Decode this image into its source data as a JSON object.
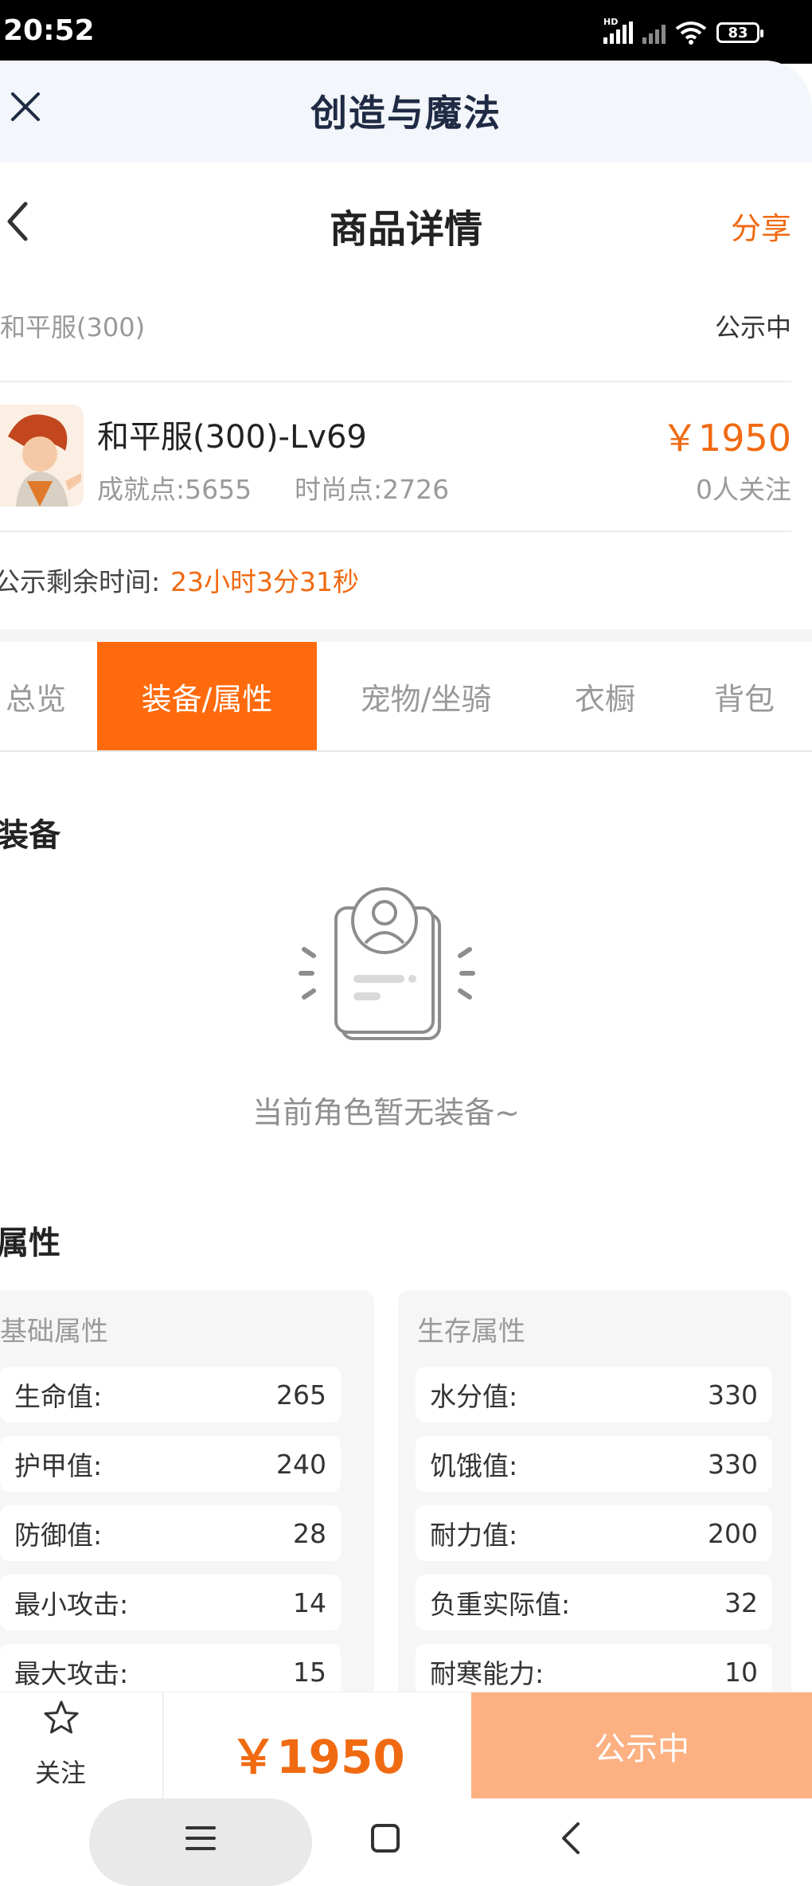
{
  "status_bar": {
    "time": "20:52",
    "network_label": "HD",
    "battery": "83"
  },
  "app_bar": {
    "title": "创造与魔法"
  },
  "nav": {
    "title": "商品详情",
    "share_label": "分享"
  },
  "product": {
    "server": "和平服(300)",
    "status": "公示中",
    "name": "和平服(300)-Lv69",
    "achievement": "成就点:5655",
    "fashion": "时尚点:2726",
    "price": "￥1950",
    "followers": "0人关注",
    "remaining_label": "公示剩余时间:",
    "remaining_value": "23小时3分31秒"
  },
  "tabs": [
    {
      "label": "总览",
      "active": false
    },
    {
      "label": "装备/属性",
      "active": true
    },
    {
      "label": "宠物/坐骑",
      "active": false
    },
    {
      "label": "衣橱",
      "active": false
    },
    {
      "label": "背包",
      "active": false
    }
  ],
  "equipment": {
    "title": "装备",
    "empty_text": "当前角色暂无装备~"
  },
  "attributes": {
    "title": "属性",
    "basic": {
      "title": "基础属性",
      "rows": [
        {
          "label": "生命值:",
          "value": "265"
        },
        {
          "label": "护甲值:",
          "value": "240"
        },
        {
          "label": "防御值:",
          "value": "28"
        },
        {
          "label": "最小攻击:",
          "value": "14"
        },
        {
          "label": "最大攻击:",
          "value": "15"
        }
      ]
    },
    "survival": {
      "title": "生存属性",
      "rows": [
        {
          "label": "水分值:",
          "value": "330"
        },
        {
          "label": "饥饿值:",
          "value": "330"
        },
        {
          "label": "耐力值:",
          "value": "200"
        },
        {
          "label": "负重实际值:",
          "value": "32"
        },
        {
          "label": "耐寒能力:",
          "value": "10"
        }
      ]
    }
  },
  "bottom_bar": {
    "follow_label": "关注",
    "price": "￥1950",
    "status_button": "公示中"
  },
  "colors": {
    "accent": "#f06a12",
    "tab_active": "#ff6a0c",
    "status_button": "#fdb081"
  }
}
